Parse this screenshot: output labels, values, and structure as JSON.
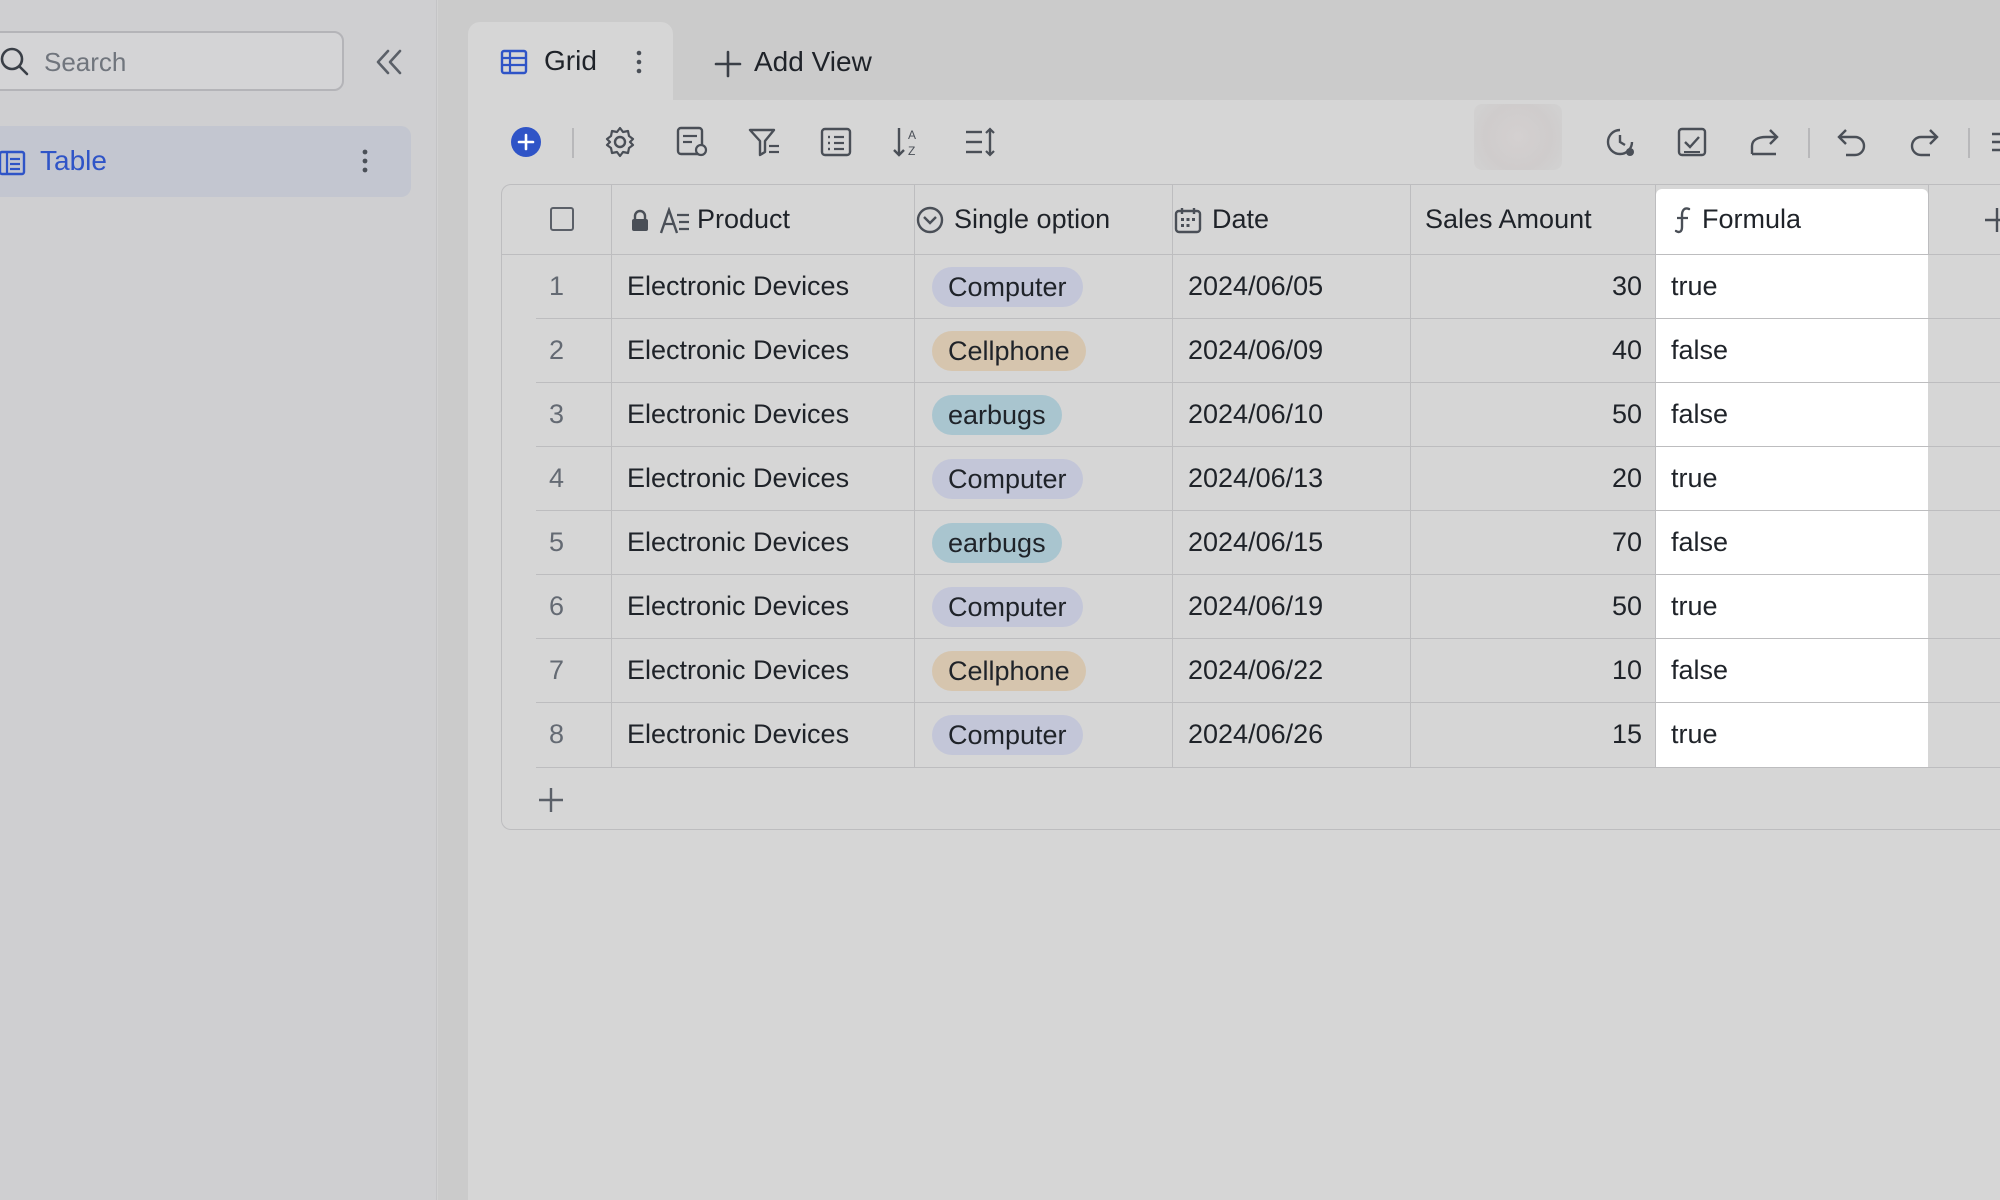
{
  "sidebar": {
    "search_placeholder": "Search",
    "items": [
      {
        "label": "Table"
      }
    ]
  },
  "tabs": [
    {
      "label": "Grid"
    }
  ],
  "add_view_label": "Add View",
  "columns": {
    "product": "Product",
    "single_option": "Single option",
    "date": "Date",
    "sales_amount": "Sales Amount",
    "formula": "Formula"
  },
  "rows": [
    {
      "num": "1",
      "product": "Electronic Devices",
      "option": "Computer",
      "date": "2024/06/05",
      "amount": "30",
      "formula": "true"
    },
    {
      "num": "2",
      "product": "Electronic Devices",
      "option": "Cellphone",
      "date": "2024/06/09",
      "amount": "40",
      "formula": "false"
    },
    {
      "num": "3",
      "product": "Electronic Devices",
      "option": "earbugs",
      "date": "2024/06/10",
      "amount": "50",
      "formula": "false"
    },
    {
      "num": "4",
      "product": "Electronic Devices",
      "option": "Computer",
      "date": "2024/06/13",
      "amount": "20",
      "formula": "true"
    },
    {
      "num": "5",
      "product": "Electronic Devices",
      "option": "earbugs",
      "date": "2024/06/15",
      "amount": "70",
      "formula": "false"
    },
    {
      "num": "6",
      "product": "Electronic Devices",
      "option": "Computer",
      "date": "2024/06/19",
      "amount": "50",
      "formula": "true"
    },
    {
      "num": "7",
      "product": "Electronic Devices",
      "option": "Cellphone",
      "date": "2024/06/22",
      "amount": "10",
      "formula": "false"
    },
    {
      "num": "8",
      "product": "Electronic Devices",
      "option": "Computer",
      "date": "2024/06/26",
      "amount": "15",
      "formula": "true"
    }
  ],
  "option_colors": {
    "Computer": "#c3c6d8",
    "Cellphone": "#d6c5ae",
    "earbugs": "#a9c5cf"
  },
  "accent_color": "#2f54c7"
}
